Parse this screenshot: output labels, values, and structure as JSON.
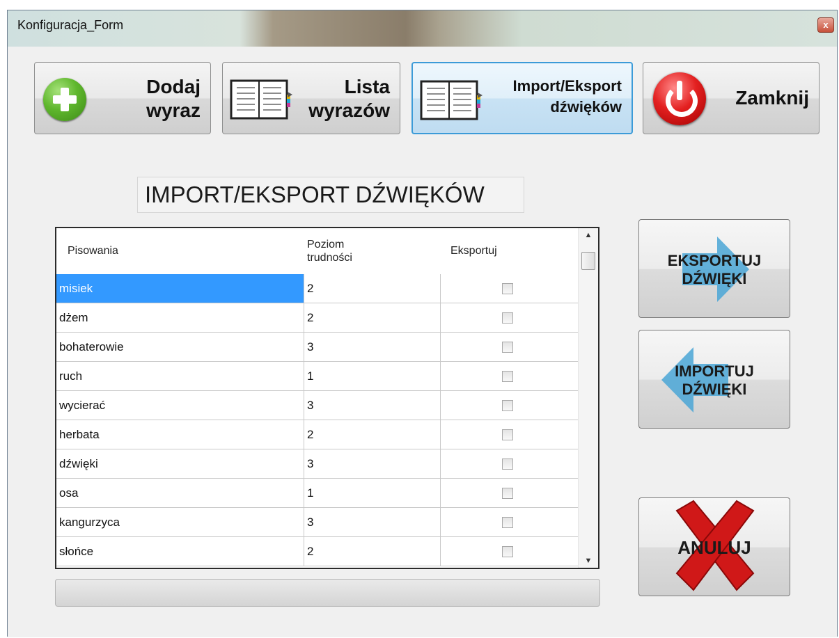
{
  "window": {
    "title": "Konfiguracja_Form",
    "close_glyph": "x"
  },
  "toolbar": {
    "add": {
      "line1": "Dodaj",
      "line2": "wyraz",
      "icon": "plus-icon"
    },
    "list": {
      "line1": "Lista",
      "line2": "wyrazów",
      "icon": "book-icon"
    },
    "import_export": {
      "line1": "Import/Eksport",
      "line2": "dźwięków",
      "icon": "book-icon"
    },
    "close": {
      "label": "Zamknij",
      "icon": "power-icon"
    }
  },
  "heading": "IMPORT/EKSPORT DŹWIĘKÓW",
  "table": {
    "headers": {
      "word": "Pisowania",
      "level_line1": "Poziom",
      "level_line2": "trudności",
      "export": "Eksportuj"
    },
    "rows": [
      {
        "word": "misiek",
        "level": "2",
        "export": false,
        "selected": true
      },
      {
        "word": "dżem",
        "level": "2",
        "export": false
      },
      {
        "word": "bohaterowie",
        "level": "3",
        "export": false
      },
      {
        "word": "ruch",
        "level": "1",
        "export": false
      },
      {
        "word": "wycierać",
        "level": "3",
        "export": false
      },
      {
        "word": "herbata",
        "level": "2",
        "export": false
      },
      {
        "word": "dźwięki",
        "level": "3",
        "export": false
      },
      {
        "word": "osa",
        "level": "1",
        "export": false
      },
      {
        "word": "kangurzyca",
        "level": "3",
        "export": false
      },
      {
        "word": "słońce",
        "level": "2",
        "export": false
      }
    ]
  },
  "progress": 0,
  "side": {
    "export": {
      "line1": "EKSPORTUJ",
      "line2": "DŹWIĘKI",
      "icon": "arrow-right-icon"
    },
    "import": {
      "line1": "IMPORTUJ",
      "line2": "DŹWIĘKI",
      "icon": "arrow-left-icon"
    },
    "cancel": {
      "label": "ANULUJ",
      "icon": "red-x-icon"
    }
  },
  "colors": {
    "selection": "#3399ff",
    "active_border": "#3c9bd8",
    "arrow": "#4aa6d6",
    "cancel_x": "#d01818"
  }
}
